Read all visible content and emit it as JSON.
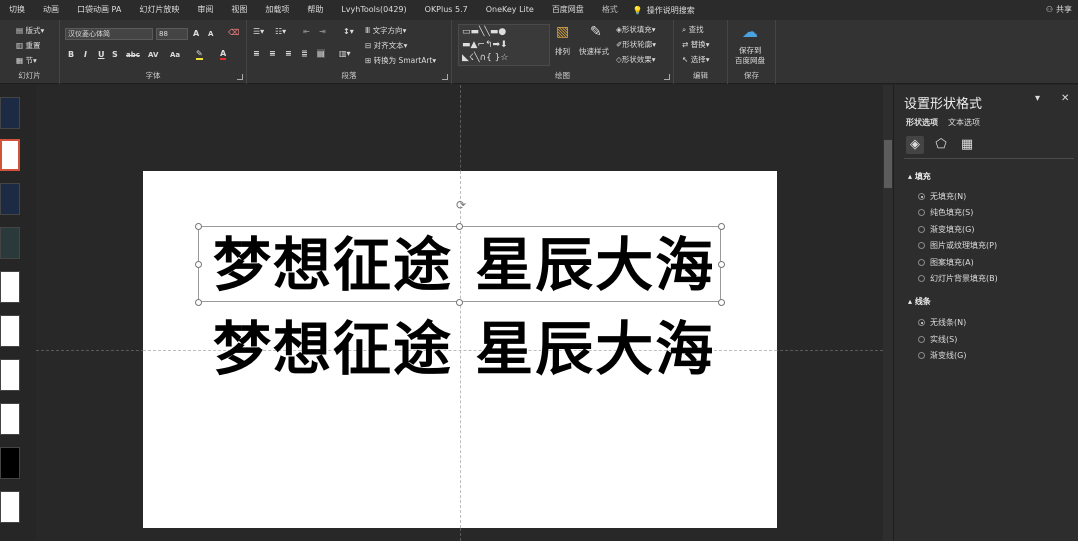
{
  "tabs": [
    "切换",
    "动画",
    "口袋动画 PA",
    "幻灯片放映",
    "审阅",
    "视图",
    "加载项",
    "帮助",
    "LvyhTools(0429)",
    "OKPlus 5.7",
    "OneKey Lite",
    "百度网盘",
    "格式"
  ],
  "tell_me": "操作说明搜索",
  "share": "共享",
  "ribbon": {
    "slides_group": {
      "label": "幻灯片",
      "layout": "版式",
      "reset": "重置",
      "section": "节"
    },
    "font_group": {
      "label": "字体",
      "font_name": "汉仪菱心体简",
      "font_size": "88",
      "bold": "B",
      "italic": "I",
      "underline": "U",
      "strike": "S",
      "abc": "abc",
      "spacing": "AV",
      "case": "Aa"
    },
    "paragraph_group": {
      "label": "段落",
      "text_direction": "文字方向",
      "align_text": "对齐文本",
      "smartart": "转换为 SmartArt"
    },
    "drawing_group": {
      "label": "绘图",
      "arrange": "排列",
      "quick_styles": "快速样式",
      "shape_fill": "形状填充",
      "shape_outline": "形状轮廓",
      "shape_effects": "形状效果"
    },
    "editing_group": {
      "label": "编辑",
      "find": "查找",
      "replace": "替换",
      "select": "选择"
    },
    "save_group": {
      "label": "保存",
      "save_to": "保存到",
      "baidu": "百度网盘"
    }
  },
  "slide": {
    "line1": "梦想征途 星辰大海",
    "line2": "梦想征途 星辰大海"
  },
  "pane": {
    "title": "设置形状格式",
    "tab_shape": "形状选项",
    "tab_text": "文本选项",
    "fill_section": "填充",
    "fill_options": [
      "无填充(N)",
      "纯色填充(S)",
      "渐变填充(G)",
      "图片或纹理填充(P)",
      "图案填充(A)",
      "幻灯片背景填充(B)"
    ],
    "line_section": "线条",
    "line_options": [
      "无线条(N)",
      "实线(S)",
      "渐变线(G)"
    ]
  }
}
